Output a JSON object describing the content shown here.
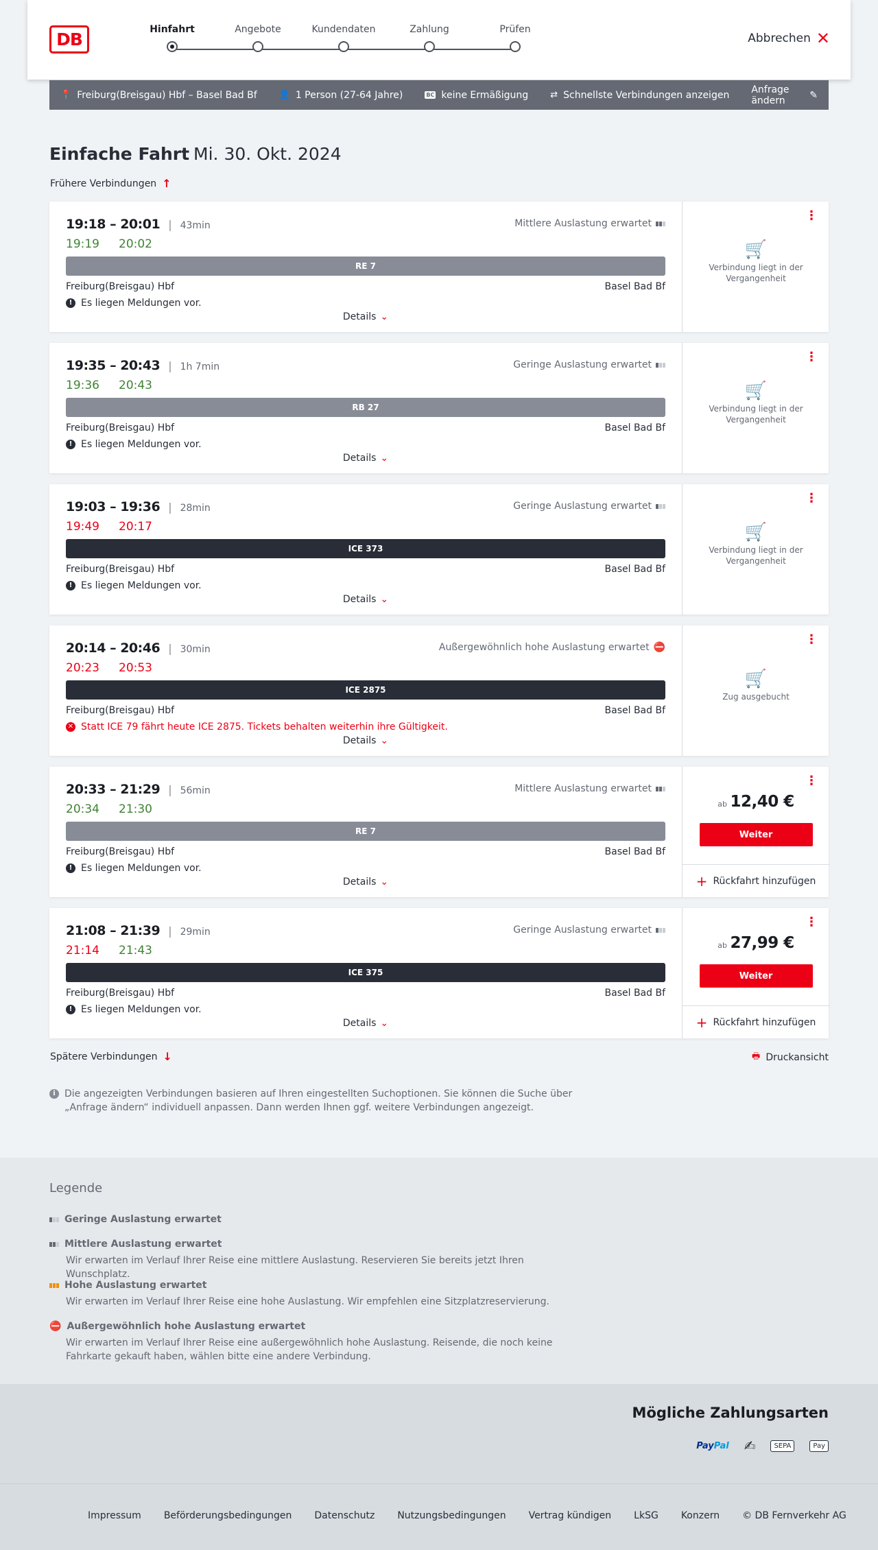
{
  "header": {
    "logo": "DB",
    "steps": [
      "Hinfahrt",
      "Angebote",
      "Kundendaten",
      "Zahlung",
      "Prüfen"
    ],
    "active_step": "Hinfahrt",
    "cancel_label": "Abbrechen"
  },
  "search": {
    "route": "Freiburg(Breisgau) Hbf – Basel Bad Bf",
    "travellers": "1 Person (27-64 Jahre)",
    "bc_badge": "BC",
    "discount": "keine Ermäßigung",
    "fastest": "Schnellste Verbindungen anzeigen",
    "change": "Anfrage ändern"
  },
  "page": {
    "title": "Einfache Fahrt",
    "date": "Mi. 30. Okt. 2024",
    "earlier": "Frühere Verbindungen",
    "later": "Spätere Verbindungen",
    "print": "Druckansicht",
    "note": "Die angezeigten Verbindungen basieren auf Ihren eingestellten Suchoptionen. Sie können die Suche über „Anfrage ändern“ individuell anpassen. Dann werden Ihnen ggf. weitere Verbindungen angezeigt."
  },
  "connections": [
    {
      "times": "19:18 – 20:01",
      "duration": "43min",
      "rt_dep": "19:19",
      "rt_arr": "20:02",
      "rt_dep_color": "#408335",
      "rt_arr_color": "#408335",
      "occupancy": "Mittlere Auslastung erwartet",
      "train": "RE 7",
      "from": "Freiburg(Breisgau) Hbf",
      "to": "Basel Bad Bf",
      "message": "Es liegen Meldungen vor.",
      "details": "Details",
      "status": "Verbindung liegt in der Vergangenheit"
    },
    {
      "times": "19:35 – 20:43",
      "duration": "1h 7min",
      "rt_dep": "19:36",
      "rt_arr": "20:43",
      "occupancy": "Geringe Auslastung erwartet",
      "train": "RB 27",
      "from": "Freiburg(Breisgau) Hbf",
      "to": "Basel Bad Bf",
      "message": "Es liegen Meldungen vor.",
      "details": "Details",
      "status": "Verbindung liegt in der Vergangenheit"
    },
    {
      "times": "19:03 – 19:36",
      "duration": "28min",
      "rt_dep": "19:49",
      "rt_arr": "20:17",
      "occupancy": "Geringe Auslastung erwartet",
      "train": "ICE 373",
      "from": "Freiburg(Breisgau) Hbf",
      "to": "Basel Bad Bf",
      "message": "Es liegen Meldungen vor.",
      "details": "Details",
      "status": "Verbindung liegt in der Vergangenheit"
    },
    {
      "times": "20:14 – 20:46",
      "duration": "30min",
      "rt_dep": "20:23",
      "rt_arr": "20:53",
      "occupancy": "Außergewöhnlich hohe Auslastung erwartet",
      "train": "ICE 2875",
      "from": "Freiburg(Breisgau) Hbf",
      "to": "Basel Bad Bf",
      "message": "Statt ICE 79 fährt heute ICE 2875. Tickets behalten weiterhin ihre Gültigkeit.",
      "details": "Details",
      "status": "Zug ausgebucht"
    },
    {
      "times": "20:33 – 21:29",
      "duration": "56min",
      "rt_dep": "20:34",
      "rt_arr": "21:30",
      "occupancy": "Mittlere Auslastung erwartet",
      "train": "RE 7",
      "from": "Freiburg(Breisgau) Hbf",
      "to": "Basel Bad Bf",
      "message": "Es liegen Meldungen vor.",
      "details": "Details",
      "price_prefix": "ab",
      "price": "12,40 €",
      "continue": "Weiter",
      "return": "Rückfahrt hinzufügen"
    },
    {
      "times": "21:08 – 21:39",
      "duration": "29min",
      "rt_dep": "21:14",
      "rt_arr": "21:43",
      "occupancy": "Geringe Auslastung erwartet",
      "train": "ICE 375",
      "from": "Freiburg(Breisgau) Hbf",
      "to": "Basel Bad Bf",
      "message": "Es liegen Meldungen vor.",
      "details": "Details",
      "price_prefix": "ab",
      "price": "27,99 €",
      "continue": "Weiter",
      "return": "Rückfahrt hinzufügen"
    }
  ],
  "legend": {
    "title": "Legende",
    "items": [
      {
        "title": "Geringe Auslastung erwartet",
        "desc": ""
      },
      {
        "title": "Mittlere Auslastung erwartet",
        "desc": "Wir erwarten im Verlauf Ihrer Reise eine mittlere Auslastung. Reservieren Sie bereits jetzt Ihren Wunschplatz."
      },
      {
        "title": "Hohe Auslastung erwartet",
        "desc": "Wir erwarten im Verlauf Ihrer Reise eine hohe Auslastung. Wir empfehlen eine Sitzplatzreservierung."
      },
      {
        "title": "Außergewöhnlich hohe Auslastung erwartet",
        "desc": "Wir erwarten im Verlauf Ihrer Reise eine außergewöhnlich hohe Auslastung. Reisende, die noch keine Fahrkarte gekauft haben, wählen bitte eine andere Verbindung."
      }
    ]
  },
  "payment": {
    "title": "Mögliche Zahlungsarten",
    "paypal_1": "Pay",
    "paypal_2": "Pal",
    "sepa": "SEPA",
    "applepay": "Pay"
  },
  "footer": {
    "links": [
      "Impressum",
      "Beförderungsbedingungen",
      "Datenschutz",
      "Nutzungsbedingungen",
      "Vertrag kündigen",
      "LkSG",
      "Konzern",
      "© DB Fernverkehr AG"
    ]
  },
  "colors": {
    "brand": "#ec0016",
    "on_time": "#408335",
    "delayed": "#ec0016",
    "info_bar": "#646973"
  }
}
